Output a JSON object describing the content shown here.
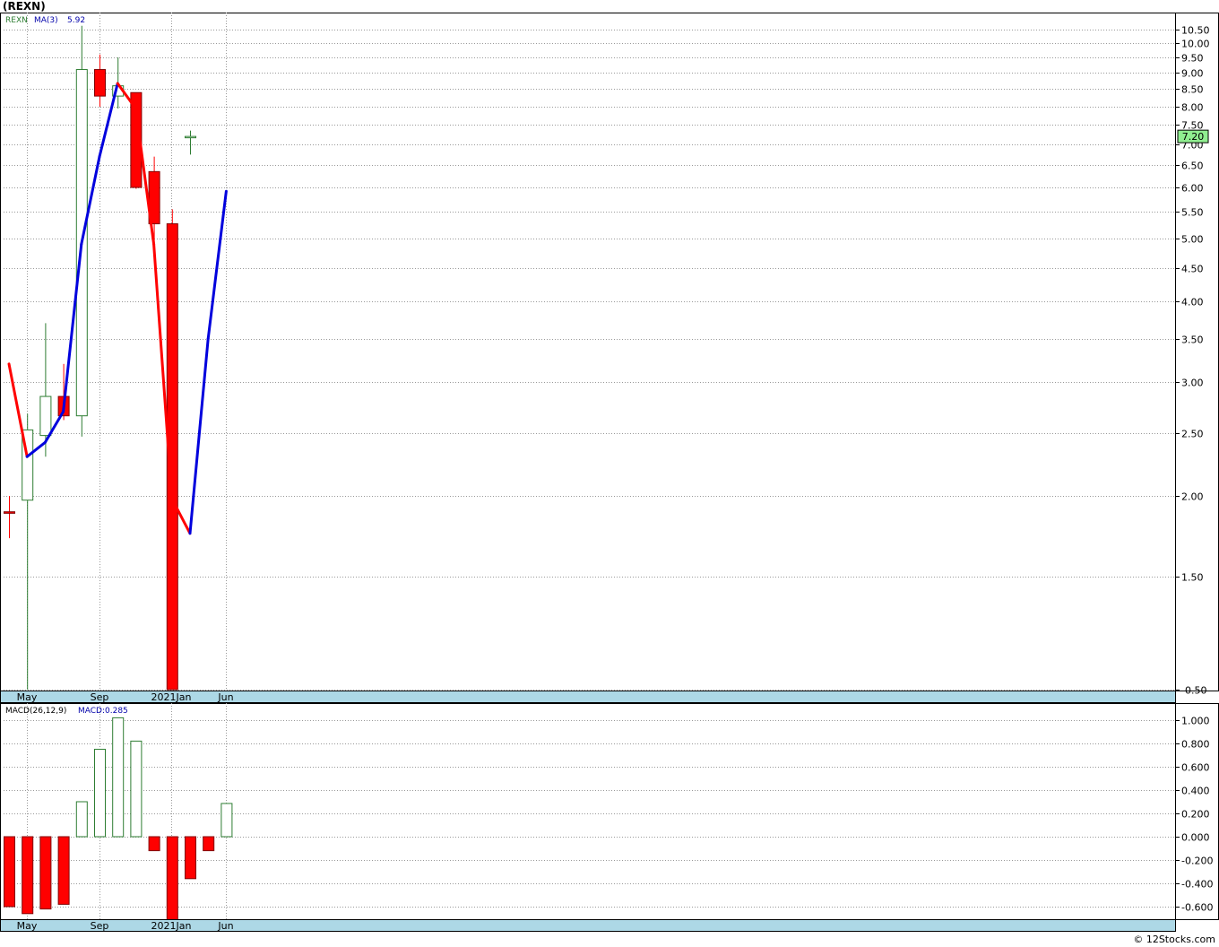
{
  "title": "(REXN)",
  "footer": "© 12Stocks.com",
  "colors": {
    "up": "#2e7d32",
    "down": "#ff0000",
    "ma_up": "#0000dd",
    "ma_down": "#ff0000",
    "timeband": "#add8e6",
    "price_tag": "#90ee90",
    "grid": "#999999"
  },
  "chart_data": [
    {
      "type": "candlestick",
      "legend": {
        "symbol": "REXN",
        "ma_label": "MA(3)",
        "ma_value": "5.92"
      },
      "y_ticks": [
        "10.50",
        "10.00",
        "9.50",
        "9.00",
        "8.50",
        "8.00",
        "7.50",
        "7.00",
        "6.50",
        "6.00",
        "5.50",
        "5.00",
        "4.50",
        "4.00",
        "3.50",
        "3.00",
        "2.50",
        "2.00",
        "1.50",
        "-0.50"
      ],
      "x_labels": [
        "May",
        "Sep",
        "2021Jan",
        "Jun"
      ],
      "last_price": "7.20",
      "candles": [
        {
          "open": 1.89,
          "high": 2.0,
          "low": 1.72,
          "close": 1.88
        },
        {
          "open": 1.97,
          "high": 2.68,
          "low": -0.5,
          "close": 2.53
        },
        {
          "open": 2.48,
          "high": 3.7,
          "low": 2.3,
          "close": 2.85
        },
        {
          "open": 2.85,
          "high": 3.2,
          "low": 2.62,
          "close": 2.66
        },
        {
          "open": 2.66,
          "high": 10.65,
          "low": 2.47,
          "close": 9.1
        },
        {
          "open": 9.1,
          "high": 9.6,
          "low": 8.0,
          "close": 8.3
        },
        {
          "open": 8.3,
          "high": 9.5,
          "low": 7.95,
          "close": 8.6
        },
        {
          "open": 8.4,
          "high": 8.4,
          "low": 5.97,
          "close": 6.0
        },
        {
          "open": 6.35,
          "high": 6.7,
          "low": 4.65,
          "close": 5.27
        },
        {
          "open": 5.27,
          "high": 5.55,
          "low": -0.5,
          "close": -0.5
        },
        {
          "open": 7.2,
          "high": 7.35,
          "low": 6.75,
          "close": 7.2
        }
      ],
      "ma": [
        3.2,
        2.3,
        2.42,
        2.7,
        4.9,
        6.7,
        8.67,
        7.95,
        4.9,
        1.98,
        1.75,
        3.5,
        5.92
      ]
    },
    {
      "type": "bar",
      "legend": {
        "indicator": "MACD(26,12,9)",
        "value_label": "MACD:0.285"
      },
      "y_ticks": [
        "1.000",
        "0.800",
        "0.600",
        "0.400",
        "0.200",
        "0.000",
        "-0.200",
        "-0.400",
        "-0.600"
      ],
      "x_labels": [
        "May",
        "Sep",
        "2021Jan",
        "Jun"
      ],
      "values": [
        -0.6,
        -0.66,
        -0.62,
        -0.58,
        0.3,
        0.75,
        1.02,
        0.82,
        -0.12,
        -0.72,
        -0.36,
        -0.12,
        0.285
      ]
    }
  ]
}
